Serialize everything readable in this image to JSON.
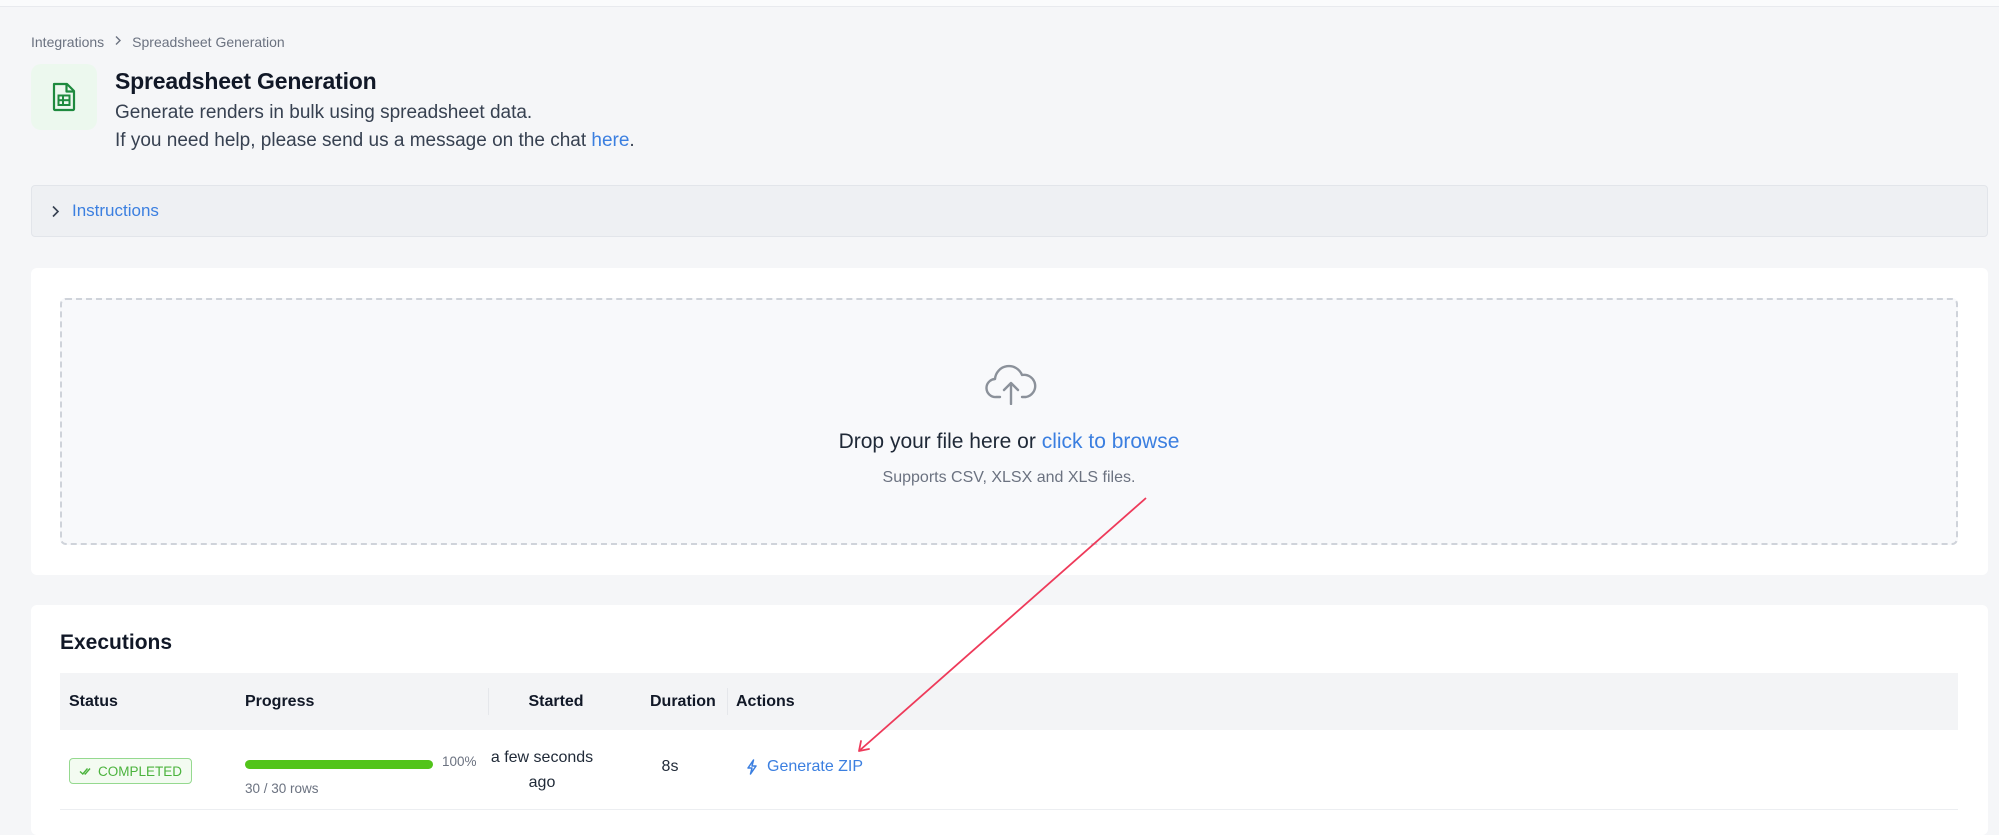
{
  "breadcrumb": {
    "parent": "Integrations",
    "current": "Spreadsheet Generation"
  },
  "header": {
    "title": "Spreadsheet Generation",
    "description": "Generate renders in bulk using spreadsheet data.",
    "help_prefix": "If you need help, please send us a message on the chat ",
    "help_link": "here",
    "help_suffix": ".",
    "icon": "spreadsheet-icon"
  },
  "instructions": {
    "label": "Instructions",
    "icon": "chevron-right-icon"
  },
  "upload": {
    "icon": "cloud-upload-icon",
    "prompt": "Drop your file here or ",
    "browse_link": "click to browse",
    "supported": "Supports CSV, XLSX and XLS files."
  },
  "executions": {
    "title": "Executions",
    "columns": [
      "Status",
      "Progress",
      "Started",
      "Duration",
      "Actions"
    ],
    "rows": [
      {
        "status": "COMPLETED",
        "progress_fraction": 1.0,
        "progress_pct": "100%",
        "rows_label": "30 / 30 rows",
        "started_line1": "a few seconds",
        "started_line2": "ago",
        "duration": "8s",
        "action": "Generate ZIP"
      }
    ]
  },
  "colors": {
    "accent": "#3b7fe0",
    "success": "#52c41a",
    "annotation": "#ee3a5a"
  }
}
